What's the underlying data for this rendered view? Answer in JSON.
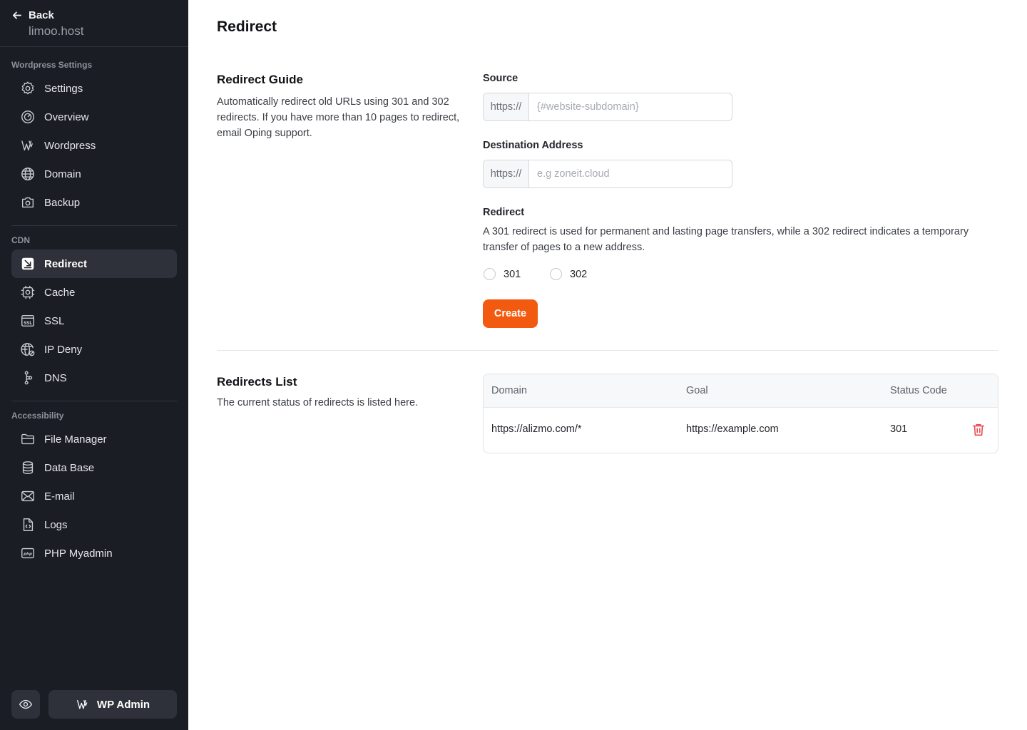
{
  "sidebar": {
    "back_label": "Back",
    "site_name": "limoo.host",
    "sections": [
      {
        "title": "Wordpress Settings",
        "items": [
          {
            "label": "Settings",
            "icon": "gear-icon"
          },
          {
            "label": "Overview",
            "icon": "gauge-icon"
          },
          {
            "label": "Wordpress",
            "icon": "wordpress-icon"
          },
          {
            "label": "Domain",
            "icon": "globe-icon"
          },
          {
            "label": "Backup",
            "icon": "camera-icon"
          }
        ]
      },
      {
        "title": "CDN",
        "items": [
          {
            "label": "Redirect",
            "icon": "redirect-icon",
            "active": true
          },
          {
            "label": "Cache",
            "icon": "chip-icon"
          },
          {
            "label": "SSL",
            "icon": "ssl-icon"
          },
          {
            "label": "IP Deny",
            "icon": "globe-deny-icon"
          },
          {
            "label": "DNS",
            "icon": "dns-icon"
          }
        ]
      },
      {
        "title": "Accessibility",
        "items": [
          {
            "label": "File Manager",
            "icon": "folder-icon"
          },
          {
            "label": "Data Base",
            "icon": "database-icon"
          },
          {
            "label": "E-mail",
            "icon": "mail-icon"
          },
          {
            "label": "Logs",
            "icon": "code-file-icon"
          },
          {
            "label": "PHP Myadmin",
            "icon": "php-icon"
          }
        ]
      }
    ],
    "footer": {
      "wp_admin_label": "WP Admin"
    }
  },
  "main": {
    "title": "Redirect",
    "guide": {
      "title": "Redirect Guide",
      "description": "Automatically redirect old URLs using 301 and 302 redirects. If you have more than 10 pages to redirect, email Oping support."
    },
    "form": {
      "source_label": "Source",
      "source_prefix": "https://",
      "source_placeholder": "{#website-subdomain}",
      "destination_label": "Destination Address",
      "destination_prefix": "https://",
      "destination_placeholder": "e.g zoneit.cloud",
      "redirect_label": "Redirect",
      "redirect_description": "A 301 redirect is used for permanent and lasting page transfers, while a 302 redirect indicates a temporary transfer of pages to a new address.",
      "options": [
        "301",
        "302"
      ],
      "create_label": "Create"
    },
    "list": {
      "title": "Redirects List",
      "description": "The current status of redirects is listed here.",
      "columns": [
        "Domain",
        "Goal",
        "Status Code"
      ],
      "rows": [
        {
          "domain": "https://alizmo.com/*",
          "goal": "https://example.com",
          "status": "301"
        }
      ]
    }
  },
  "colors": {
    "sidebar_bg": "#1b1d24",
    "accent": "#f25a0f",
    "danger": "#e5484d"
  }
}
